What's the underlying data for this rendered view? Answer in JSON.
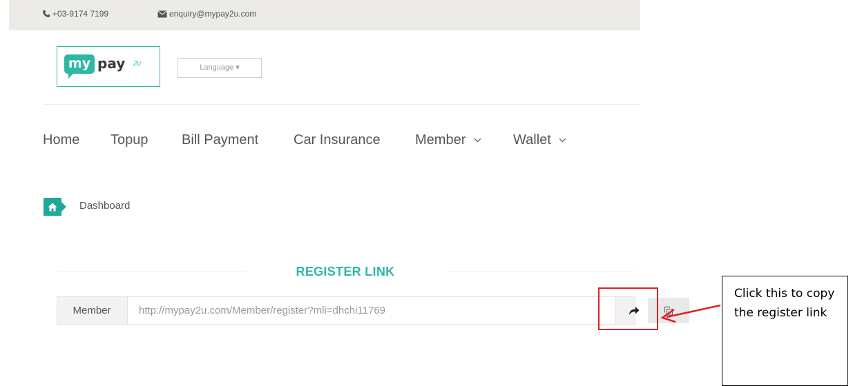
{
  "contact": {
    "phone": "+03-9174 7199",
    "email": "enquiry@mypay2u.com",
    "phone_icon": "phone-icon",
    "email_icon": "envelope-icon"
  },
  "logo": {
    "part1": "my",
    "part2": "pay",
    "part3": "2u"
  },
  "language": {
    "label": "Language ▾"
  },
  "nav": {
    "items": [
      {
        "label": "Home"
      },
      {
        "label": "Topup"
      },
      {
        "label": "Bill Payment"
      },
      {
        "label": "Car Insurance"
      },
      {
        "label": "Member"
      },
      {
        "label": "Wallet"
      }
    ]
  },
  "breadcrumb": {
    "label": "Dashboard",
    "icon": "home-icon"
  },
  "register": {
    "title": "REGISTER LINK",
    "addon_label": "Member",
    "link_value": "http://mypay2u.com/Member/register?mli=dhchi11769",
    "share_icon": "share-icon",
    "copy_icon": "copy-icon"
  },
  "callout": {
    "text": "Click this to copy the register link"
  },
  "colors": {
    "accent": "#2fb7a6",
    "highlight": "#e0201f",
    "topbar": "#ecebe7"
  }
}
